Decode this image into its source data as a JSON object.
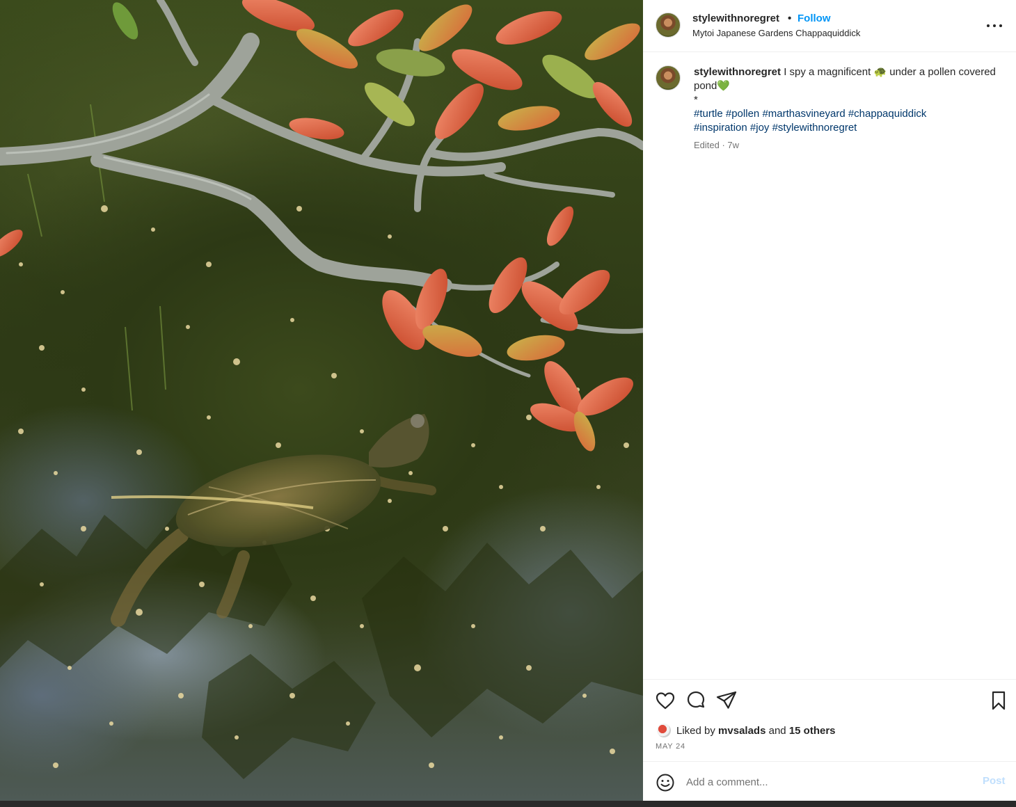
{
  "post_image": {
    "alt": "Photo by stylewithnoregret at Mytoi Japanese Gardens Chappaquiddick"
  },
  "header": {
    "username": "stylewithnoregret",
    "separator": "•",
    "follow_label": "Follow",
    "location": "Mytoi Japanese Gardens Chappaquiddick",
    "more_icon": "more-horizontal-icon"
  },
  "caption": {
    "username": "stylewithnoregret",
    "text_part1": " I spy a magnificent ",
    "emoji_turtle": "🐢",
    "text_part2": " under a pollen covered pond",
    "emoji_heart": "💚",
    "asterisk": "*",
    "hashtags": [
      "#turtle",
      "#pollen",
      "#marthasvineyard",
      "#chappaquiddick",
      "#inspiration",
      "#joy",
      "#stylewithnoregret"
    ],
    "meta": "Edited · 7w"
  },
  "actions": {
    "like_icon": "heart-icon",
    "comment_icon": "comment-icon",
    "share_icon": "share-icon",
    "save_icon": "bookmark-icon"
  },
  "likes": {
    "prefix": "Liked by ",
    "first_liker": "mvsalads",
    "connector": " and ",
    "others": "15 others"
  },
  "date": "MAY 24",
  "comment": {
    "placeholder": "Add a comment...",
    "post_label": "Post"
  },
  "colors": {
    "accent": "#0095f6",
    "hashtag": "#00376b",
    "muted": "#737373",
    "post_disabled": "#c0dffd"
  }
}
